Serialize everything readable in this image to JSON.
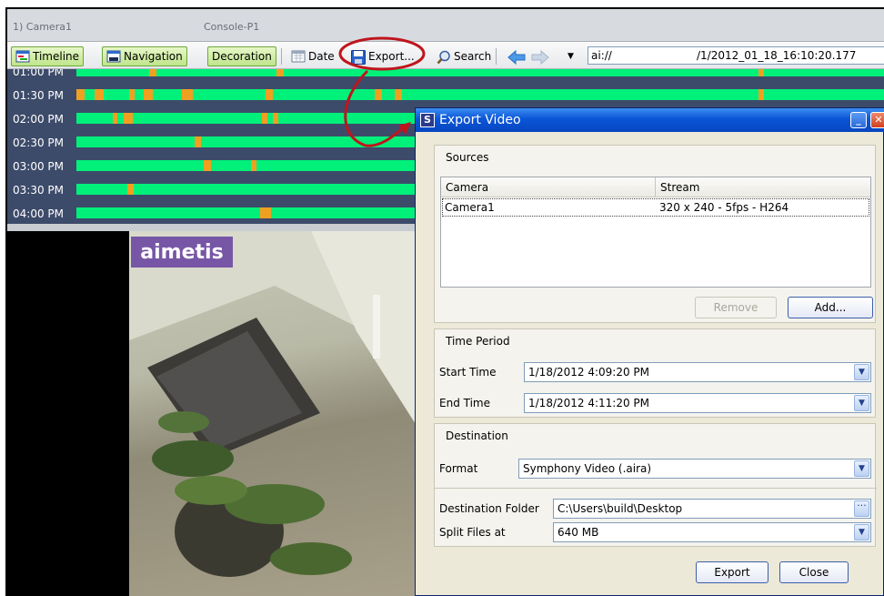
{
  "tabs": [
    "1) Camera1",
    "Console-P1"
  ],
  "toolbar": {
    "timeline": "Timeline",
    "navigation": "Navigation",
    "decoration": "Decoration",
    "date": "Date",
    "export": "Export...",
    "search": "Search",
    "address_scheme": "ai://",
    "address_path": "/1/2012_01_18_16:10:20.177"
  },
  "timeline": {
    "rows": [
      {
        "label": "01:00 PM"
      },
      {
        "label": "01:30 PM"
      },
      {
        "label": "02:00 PM"
      },
      {
        "label": "02:30 PM"
      },
      {
        "label": "03:00 PM"
      },
      {
        "label": "03:30 PM"
      },
      {
        "label": "04:00 PM"
      }
    ]
  },
  "video": {
    "logo": "aimetis"
  },
  "dialog": {
    "title": "Export Video",
    "sources": {
      "heading": "Sources",
      "col_camera": "Camera",
      "col_stream": "Stream",
      "rows": [
        {
          "camera": "Camera1",
          "stream": "320 x 240 - 5fps - H264"
        }
      ],
      "remove": "Remove",
      "add": "Add..."
    },
    "time_period": {
      "heading": "Time Period",
      "start_label": "Start Time",
      "start_value": "1/18/2012 4:09:20 PM",
      "end_label": "End Time",
      "end_value": "1/18/2012 4:11:20 PM"
    },
    "destination": {
      "heading": "Destination",
      "format_label": "Format",
      "format_value": "Symphony Video (.aira)",
      "folder_label": "Destination Folder",
      "folder_value": "C:\\Users\\build\\Desktop",
      "split_label": "Split Files at",
      "split_value": "640 MB"
    },
    "export_button": "Export",
    "close_button": "Close"
  },
  "colors": {
    "timeline_bg": "#3d4b6a",
    "motion_green": "#00f07a",
    "event_orange": "#f0a020",
    "annotation_red": "#c0141c",
    "dialog_title_blue": "#0a55d8"
  }
}
